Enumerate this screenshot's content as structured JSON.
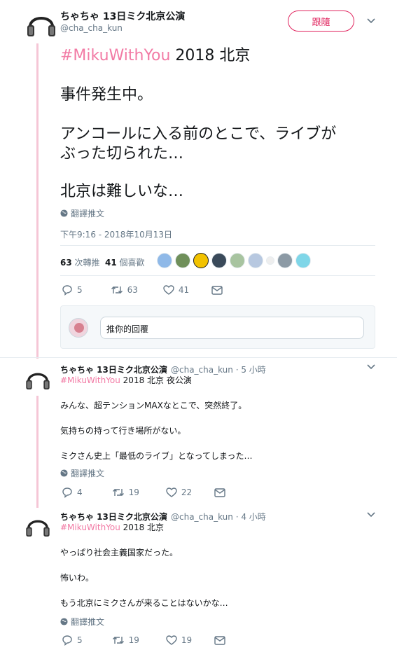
{
  "main_tweet": {
    "author_name": "ちゃちゃ 13日ミク北京公演",
    "handle": "@cha_cha_kun",
    "follow_label": "跟隨",
    "hashtag": "#MikuWithYou",
    "line1_rest": " 2018 北京",
    "line2": "事件発生中。",
    "line3": "アンコールに入る前のとこで、ライブが",
    "line4": "ぶった切られた…",
    "line5": "北京は難しいな…",
    "translate_label": "翻譯推文",
    "timestamp": "下午9:16 - 2018年10月13日",
    "retweets_count": "63",
    "retweets_label": "次轉推",
    "likes_count": "41",
    "likes_label": "個喜歡",
    "action_replies": "5",
    "action_retweets": "63",
    "action_likes": "41",
    "reply_placeholder": "推你的回覆"
  },
  "replies": [
    {
      "author_name": "ちゃちゃ 13日ミク北京公演",
      "handle_time": "@cha_cha_kun · 5 小時",
      "hashtag": "#MikuWithYou",
      "hashtag_rest": " 2018 北京 夜公演",
      "line1": "みんな、超テンションMAXなとこで、突然終了。",
      "line2": "気持ちの持って行き場所がない。",
      "line3": "ミクさん史上「最低のライブ」となってしまった…",
      "translate_label": "翻譯推文",
      "replies": "4",
      "retweets": "19",
      "likes": "22"
    },
    {
      "author_name": "ちゃちゃ 13日ミク北京公演",
      "handle_time": "@cha_cha_kun · 4 小時",
      "hashtag": "#MikuWithYou",
      "hashtag_rest": " 2018 北京",
      "line1": "やっぱり社会主義国家だった。",
      "line2": "怖いわ。",
      "line3": "もう北京にミクさんが来ることはないかな…",
      "translate_label": "翻譯推文",
      "replies": "5",
      "retweets": "19",
      "likes": "19"
    }
  ],
  "colors": {
    "hashtag": "#f27ba5",
    "follow_accent": "#e0245e",
    "thread_line": "#f5c6d6",
    "muted": "#657786"
  },
  "icons": [
    "headphones-avatar-icon",
    "globe-icon",
    "reply-icon",
    "retweet-icon",
    "heart-icon",
    "message-icon",
    "chevron-down-icon"
  ]
}
